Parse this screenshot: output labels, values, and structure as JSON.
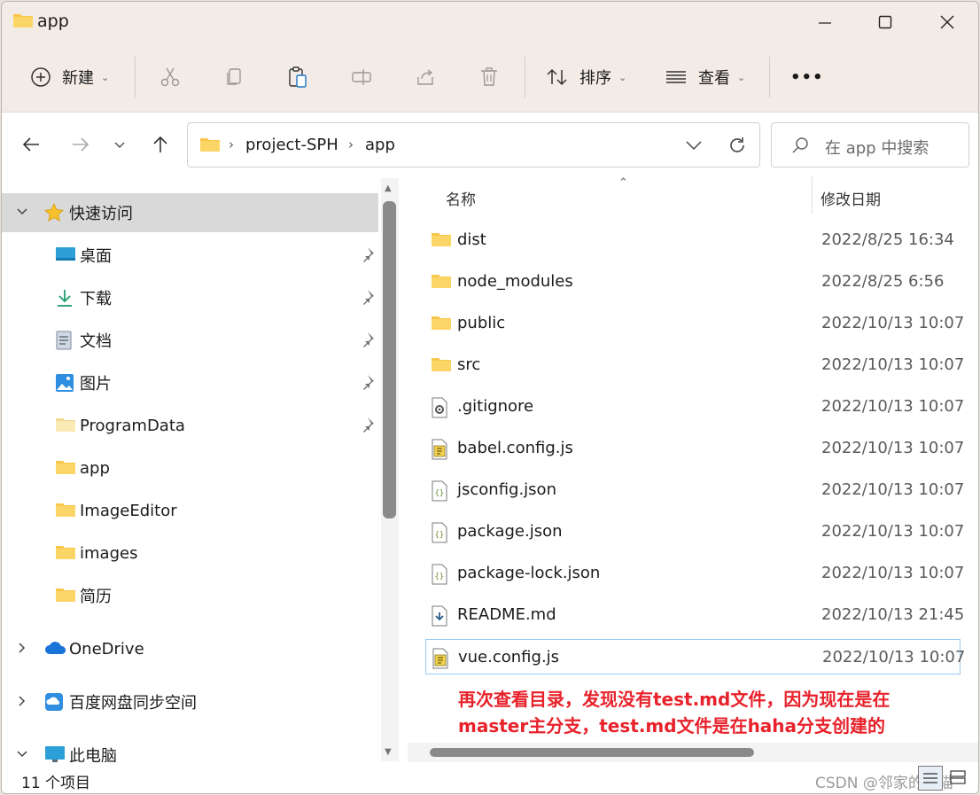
{
  "window": {
    "title": "app"
  },
  "toolbar": {
    "new_label": "新建",
    "sort_label": "排序",
    "view_label": "查看",
    "more_label": "•••"
  },
  "address": {
    "crumbs": [
      "project-SPH",
      "app"
    ]
  },
  "search": {
    "placeholder": "在 app 中搜索"
  },
  "nav": {
    "quick_access": "快速访问",
    "items": [
      {
        "label": "桌面",
        "icon": "desktop-icon",
        "pinned": true
      },
      {
        "label": "下载",
        "icon": "download-icon",
        "pinned": true
      },
      {
        "label": "文档",
        "icon": "document-icon",
        "pinned": true
      },
      {
        "label": "图片",
        "icon": "picture-icon",
        "pinned": true
      },
      {
        "label": "ProgramData",
        "icon": "folder-icon",
        "pinned": true
      },
      {
        "label": "app",
        "icon": "folder-icon",
        "pinned": false
      },
      {
        "label": "ImageEditor",
        "icon": "folder-icon",
        "pinned": false
      },
      {
        "label": "images",
        "icon": "folder-icon",
        "pinned": false
      },
      {
        "label": "简历",
        "icon": "folder-icon",
        "pinned": false
      }
    ],
    "onedrive": "OneDrive",
    "baidu": "百度网盘同步空间",
    "thispc": "此电脑"
  },
  "columns": {
    "name": "名称",
    "modified": "修改日期"
  },
  "files": [
    {
      "name": "dist",
      "date": "2022/8/25 16:34",
      "icon": "folder-icon"
    },
    {
      "name": "node_modules",
      "date": "2022/8/25 6:56",
      "icon": "folder-icon"
    },
    {
      "name": "public",
      "date": "2022/10/13 10:07",
      "icon": "folder-icon"
    },
    {
      "name": "src",
      "date": "2022/10/13 10:07",
      "icon": "folder-icon"
    },
    {
      "name": ".gitignore",
      "date": "2022/10/13 10:07",
      "icon": "config-file-icon"
    },
    {
      "name": "babel.config.js",
      "date": "2022/10/13 10:07",
      "icon": "js-file-icon"
    },
    {
      "name": "jsconfig.json",
      "date": "2022/10/13 10:07",
      "icon": "json-file-icon"
    },
    {
      "name": "package.json",
      "date": "2022/10/13 10:07",
      "icon": "json-file-icon"
    },
    {
      "name": "package-lock.json",
      "date": "2022/10/13 10:07",
      "icon": "json-file-icon"
    },
    {
      "name": "README.md",
      "date": "2022/10/13 21:45",
      "icon": "markdown-file-icon"
    },
    {
      "name": "vue.config.js",
      "date": "2022/10/13 10:07",
      "icon": "js-file-icon"
    }
  ],
  "annotation": {
    "line1": "再次查看目录，发现没有test.md文件，因为现在是在",
    "line2": "master主分支，test.md文件是在haha分支创建的"
  },
  "status": {
    "count": "11 个项目"
  },
  "watermark": "CSDN @邻家的吕猫",
  "colors": {
    "folder": "#f8c64a",
    "annotation": "#e8222b",
    "selection": "#d9d9d9",
    "accent": "#0078d4"
  }
}
